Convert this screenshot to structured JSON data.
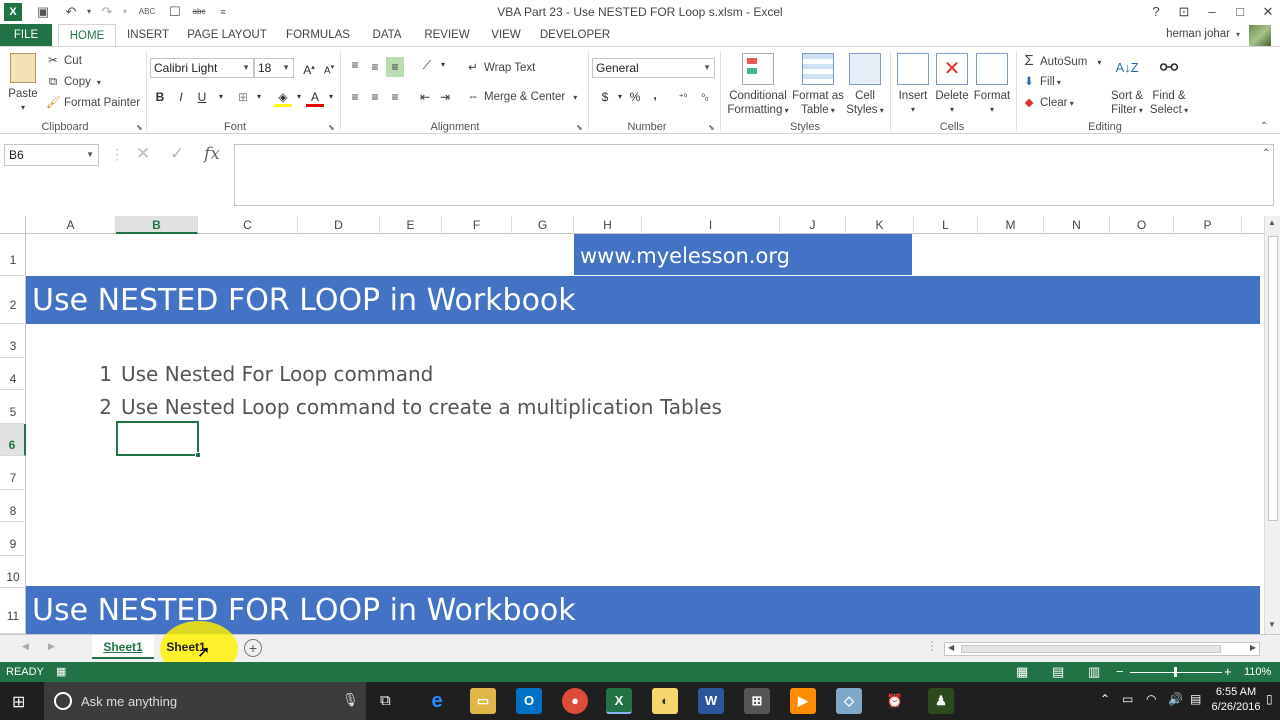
{
  "window": {
    "title": "VBA Part 23 -  Use NESTED FOR Loop s.xlsm - Excel",
    "help": "?",
    "controls": [
      "–",
      "□",
      "✕"
    ]
  },
  "ribbon_tabs": [
    "FILE",
    "HOME",
    "INSERT",
    "PAGE LAYOUT",
    "FORMULAS",
    "DATA",
    "REVIEW",
    "VIEW",
    "DEVELOPER"
  ],
  "user": {
    "name": "heman johar"
  },
  "clipboard": {
    "paste": "Paste",
    "cut": "Cut",
    "copy": "Copy",
    "format_painter": "Format Painter",
    "label": "Clipboard"
  },
  "font": {
    "family": "Calibri Light",
    "size": "18",
    "bold": "B",
    "italic": "I",
    "underline": "U",
    "label": "Font"
  },
  "alignment": {
    "wrap_text": "Wrap Text",
    "merge_center": "Merge & Center",
    "label": "Alignment"
  },
  "number": {
    "format": "General",
    "currency": "$",
    "percent": "%",
    "comma": ",",
    "label": "Number"
  },
  "styles": {
    "conditional_formatting": [
      "Conditional",
      "Formatting"
    ],
    "format_as_table": [
      "Format as",
      "Table"
    ],
    "cell_styles": [
      "Cell",
      "Styles"
    ],
    "label": "Styles"
  },
  "cells_group": {
    "insert": "Insert",
    "delete": "Delete",
    "format": "Format",
    "label": "Cells"
  },
  "editing": {
    "autosum": "AutoSum",
    "fill": "Fill",
    "clear": "Clear",
    "sort_filter": [
      "Sort &",
      "Filter"
    ],
    "find_select": [
      "Find &",
      "Select"
    ],
    "label": "Editing"
  },
  "formula_bar": {
    "name_box": "B6",
    "fx": "fx",
    "value": ""
  },
  "columns": [
    "A",
    "B",
    "C",
    "D",
    "E",
    "F",
    "G",
    "H",
    "I",
    "J",
    "K",
    "L",
    "M",
    "N",
    "O",
    "P"
  ],
  "rows": [
    "1",
    "2",
    "3",
    "4",
    "5",
    "6",
    "7",
    "8",
    "9",
    "10",
    "11"
  ],
  "sheet": {
    "url": "www.myelesson.org",
    "banner": "Use NESTED FOR LOOP in Workbook",
    "items": [
      {
        "num": "1",
        "text": "Use Nested For Loop command"
      },
      {
        "num": "2",
        "text": "Use Nested Loop command to create a multiplication Tables"
      }
    ],
    "banner2": "Use NESTED FOR LOOP in Workbook"
  },
  "sheet_tabs": [
    "Sheet1",
    "Sheet1"
  ],
  "status": {
    "mode": "READY",
    "zoom": "110%"
  },
  "taskbar": {
    "search_placeholder": "Ask me anything",
    "time": "6:55 AM",
    "date": "6/26/2016"
  },
  "colors": {
    "excel_green": "#217346",
    "banner_blue": "#4472c4"
  }
}
